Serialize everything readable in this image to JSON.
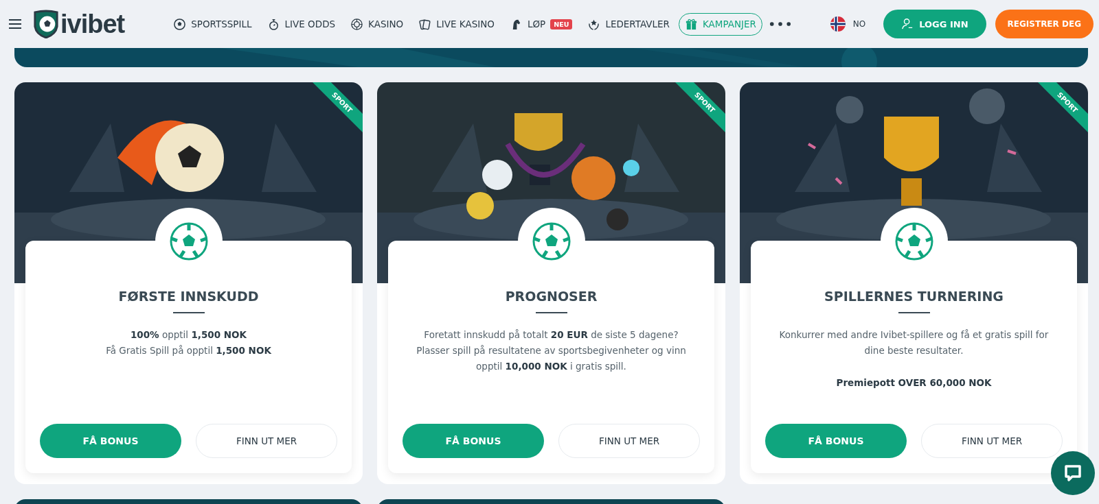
{
  "header": {
    "logo": "ivibet",
    "nav": [
      {
        "label": "SPORTSSPILL",
        "selected": false
      },
      {
        "label": "LIVE ODDS",
        "selected": false
      },
      {
        "label": "KASINO",
        "selected": false
      },
      {
        "label": "LIVE KASINO",
        "selected": false
      },
      {
        "label": "LØP",
        "badge": "NEU",
        "selected": false
      },
      {
        "label": "LEDERTAVLER",
        "selected": false
      },
      {
        "label": "KAMPANJER",
        "selected": true
      }
    ],
    "language": "NO",
    "login": "LOGG INN",
    "register": "REGISTRER DEG"
  },
  "promotions": [
    {
      "ribbon": "SPORT",
      "title": "FØRSTE INNSKUDD",
      "description": [
        {
          "text": "**100%** opptil **1,500 NOK**",
          "bold": false
        },
        {
          "text": "Få Gratis Spill på opptil **1,500 NOK**",
          "bold": false
        }
      ],
      "primary": "FÅ BONUS",
      "secondary": "FINN UT MER"
    },
    {
      "ribbon": "SPORT",
      "title": "PROGNOSER",
      "description": [
        {
          "text": "Foretatt innskudd på totalt **20 EUR** de siste 5 dagene? Plasser spill på resultatene av sportsbegivenheter og vinn opptil **10,000 NOK** i gratis spill.",
          "bold": false
        }
      ],
      "primary": "FÅ BONUS",
      "secondary": "FINN UT MER"
    },
    {
      "ribbon": "SPORT",
      "title": "SPILLERNES TURNERING",
      "description": [
        {
          "text": "Konkurrer med andre Ivibet-spillere og få et gratis spill for dine beste resultater.",
          "bold": false
        },
        {
          "text": "Premiepott OVER 60,000 NOK",
          "bold": true
        }
      ],
      "primary": "FÅ BONUS",
      "secondary": "FINN UT MER"
    }
  ]
}
